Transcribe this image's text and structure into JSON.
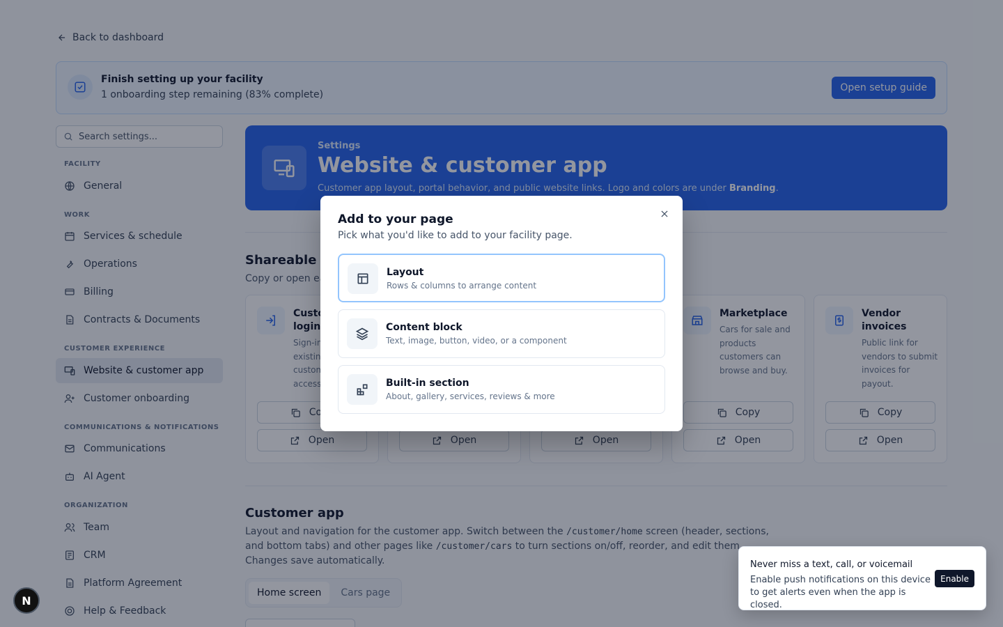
{
  "back": {
    "label": "Back to dashboard"
  },
  "setup": {
    "title": "Finish setting up your facility",
    "subtitle": "1 onboarding step remaining (83% complete)",
    "button": "Open setup guide",
    "progress_percent": 83
  },
  "sidebar": {
    "search_placeholder": "Search settings...",
    "sections": {
      "facility": "FACILITY",
      "work": "WORK",
      "customer": "CUSTOMER EXPERIENCE",
      "comms": "COMMUNICATIONS & NOTIFICATIONS",
      "org": "ORGANIZATION"
    },
    "items": {
      "general": "General",
      "services": "Services & schedule",
      "operations": "Operations",
      "billing": "Billing",
      "contracts": "Contracts & Documents",
      "website": "Website & customer app",
      "onboarding": "Customer onboarding",
      "communications": "Communications",
      "ai_agent": "AI Agent",
      "team": "Team",
      "crm": "CRM",
      "platform": "Platform Agreement",
      "help": "Help & Feedback"
    }
  },
  "hero": {
    "kicker": "Settings",
    "title": "Website & customer app",
    "desc_prefix": "Customer app layout, portal behavior, and public website links. Logo and colors are under",
    "desc_bold": "Branding",
    "desc_suffix": "."
  },
  "shareable": {
    "title": "Shareable links",
    "subtitle": "Copy or open each link."
  },
  "cards": {
    "login": {
      "title": "Customer login",
      "desc": "Sign-in for existing customers to access the portal."
    },
    "marketplace": {
      "title": "Marketplace",
      "desc": "Cars for sale and products customers can browse and buy."
    },
    "vendor": {
      "title": "Vendor invoices",
      "desc": "Public link for vendors to submit invoices for payout."
    },
    "copy": "Copy",
    "open": "Open"
  },
  "customer_app": {
    "title": "Customer app",
    "desc1": "Layout and navigation for the customer app. Switch between the",
    "code1": "/customer/home",
    "desc2": "screen (header, sections, and bottom tabs) and other pages like",
    "code2": "/customer/cars",
    "desc3": "to turn sections on/off, reorder, and edit them. Changes save automatically.",
    "tabs": [
      "Home screen",
      "Cars page"
    ]
  },
  "modal": {
    "title": "Add to your page",
    "subtitle": "Pick what you'd like to add to your facility page.",
    "options": [
      {
        "title": "Layout",
        "desc": "Rows & columns to arrange content"
      },
      {
        "title": "Content block",
        "desc": "Text, image, button, video, or a component"
      },
      {
        "title": "Built-in section",
        "desc": "About, gallery, services, reviews & more"
      }
    ]
  },
  "toast": {
    "title": "Never miss a text, call, or voicemail",
    "desc": "Enable push notifications on this device to get alerts even when the app is closed.",
    "button": "Enable"
  },
  "badge": {
    "letter": "N"
  },
  "colors": {
    "primary": "#2563eb",
    "overlay": "rgba(15,23,42,0.45)"
  }
}
